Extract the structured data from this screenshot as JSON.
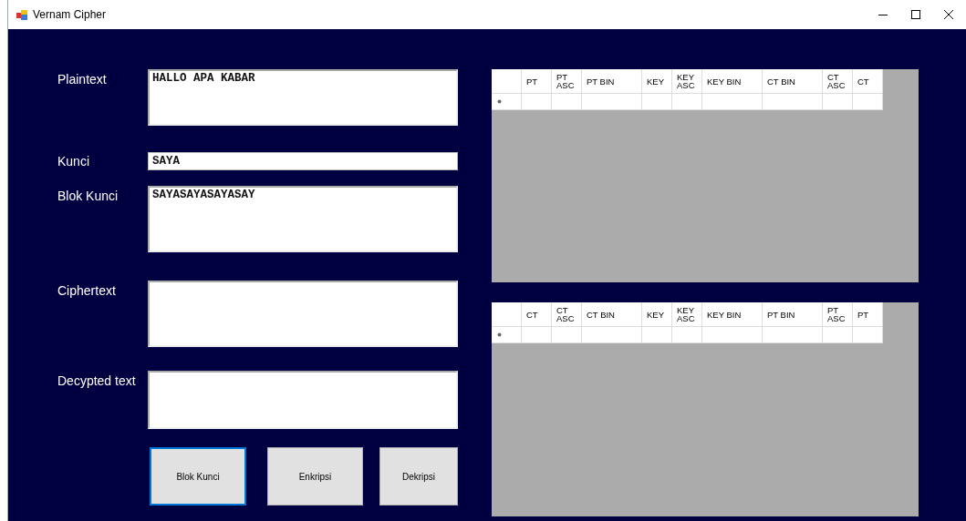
{
  "window": {
    "title": "Vernam Cipher"
  },
  "fields": [
    {
      "label": "Plaintext",
      "value": "HALLO APA KABAR",
      "kind": "multiline"
    },
    {
      "label": "Kunci",
      "value": "SAYA",
      "kind": "single"
    },
    {
      "label": "Blok Kunci",
      "value": "SAYASAYASAYASAY",
      "kind": "multiline"
    },
    {
      "label": "Ciphertext",
      "kind": "multiline"
    },
    {
      "label": "Decypted text",
      "kind": "multiline"
    }
  ],
  "buttons": [
    {
      "label": "Blok Kunci",
      "focused": true
    },
    {
      "label": "Enkripsi",
      "focused": false
    },
    {
      "label": "Dekripsi",
      "focused": false
    }
  ],
  "tables": [
    {
      "columns": [
        "PT",
        "PT ASC",
        "PT BIN",
        "KEY",
        "KEY ASC",
        "KEY BIN",
        "CT BIN",
        "CT ASC",
        "CT"
      ]
    },
    {
      "columns": [
        "CT",
        "CT ASC",
        "CT BIN",
        "KEY",
        "KEY ASC",
        "KEY BIN",
        "PT BIN",
        "PT ASC",
        "PT"
      ]
    }
  ]
}
